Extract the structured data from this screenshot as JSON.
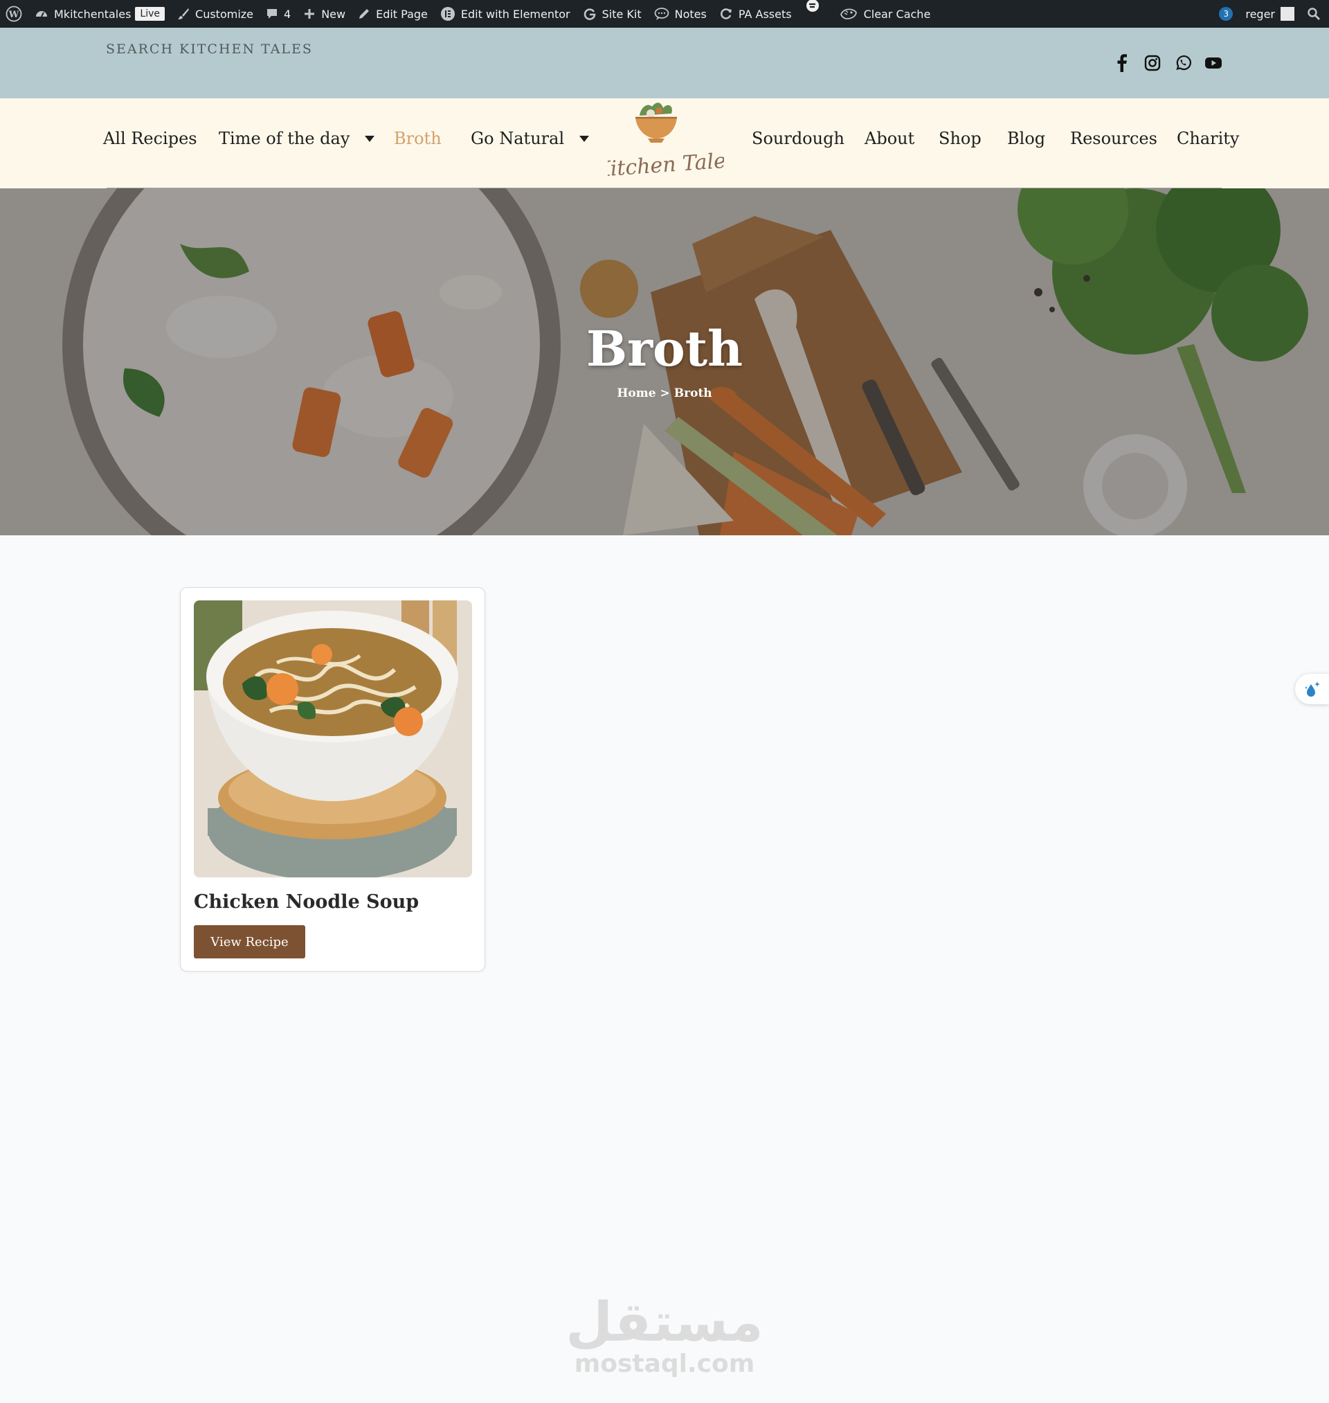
{
  "adminbar": {
    "site": "Mkitchentales",
    "live": "Live",
    "customize": "Customize",
    "comments_count": "4",
    "new": "New",
    "edit_page": "Edit Page",
    "edit_elementor": "Edit with Elementor",
    "site_kit": "Site Kit",
    "notes": "Notes",
    "pa_assets": "PA Assets",
    "clear_cache": "Clear Cache",
    "notifications": "3",
    "user": "reger"
  },
  "topbar": {
    "search_label": "SEARCH KITCHEN TALES",
    "social": [
      "facebook-icon",
      "instagram-icon",
      "whatsapp-icon",
      "youtube-icon"
    ]
  },
  "nav": {
    "left": [
      "All Recipes",
      "Time of the day",
      "Broth",
      "Go Natural"
    ],
    "right": [
      "Sourdough",
      "About",
      "Shop",
      "Blog",
      "Resources",
      "Charity"
    ],
    "active": "Broth",
    "logo_text": "Kitchen Tales"
  },
  "hero": {
    "title": "Broth",
    "breadcrumb_home": "Home",
    "breadcrumb_sep": ">",
    "breadcrumb_current": "Broth"
  },
  "recipes": [
    {
      "title": "Chicken Noodle Soup",
      "button": "View Recipe"
    }
  ],
  "watermark": {
    "arabic": "مستقل",
    "latin": "mostaql.com"
  },
  "colors": {
    "adminbar": "#1d2327",
    "topstrip": "#b5cace",
    "nav_bg": "#fdf8ea",
    "active": "#d4a06a",
    "button": "#7d5232",
    "page_bg": "#f9fafb"
  }
}
